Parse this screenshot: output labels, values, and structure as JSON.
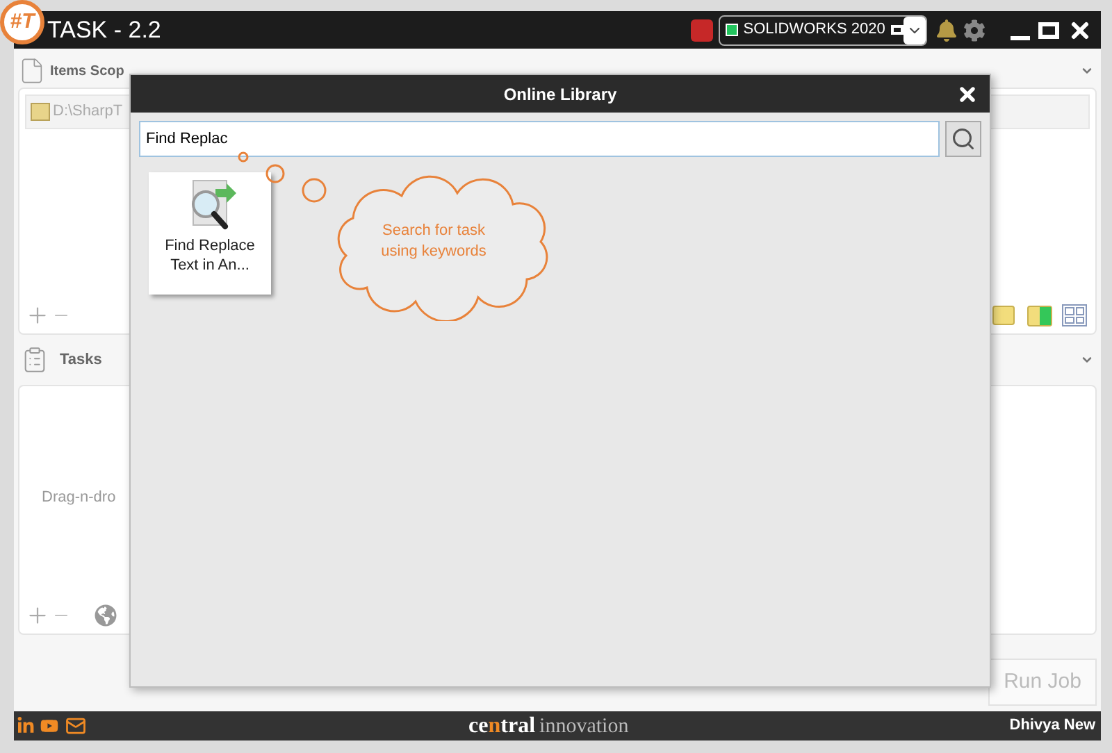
{
  "app": {
    "logo": "#T",
    "title": "TASK - 2.2",
    "selector": {
      "value": "SOLIDWORKS 2020"
    }
  },
  "items_scope": {
    "title": "Items Scop",
    "path": "D:\\SharpT"
  },
  "tasks": {
    "title": "Tasks",
    "hint": "Drag-n-dro"
  },
  "run_button": {
    "label": "Run Job",
    "disabled": true
  },
  "dialog": {
    "title": "Online Library",
    "search": {
      "value": "Find Replac"
    },
    "results": [
      {
        "label": "Find Replace Text in An..."
      }
    ],
    "callout": "Search for task using keywords"
  },
  "footer": {
    "brand": [
      {
        "text": "ce",
        "accent": false
      },
      {
        "text": "n",
        "accent": true
      },
      {
        "text": "tral",
        "accent": false
      }
    ],
    "brand_suffix": "innovation",
    "user": "Dhivya New"
  }
}
